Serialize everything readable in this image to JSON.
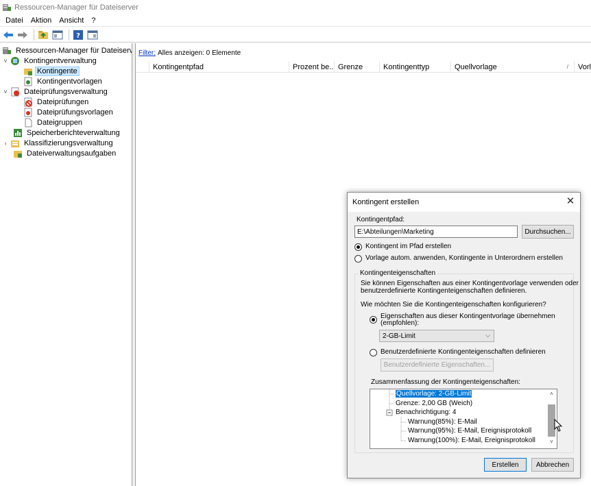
{
  "window": {
    "title": "Ressourcen-Manager für Dateiserver"
  },
  "menu": [
    "Datei",
    "Aktion",
    "Ansicht",
    "?"
  ],
  "toolbar": {
    "icons": [
      "back-arrow-icon",
      "forward-arrow-icon",
      "up-folder-icon",
      "show-hide-tree-icon",
      "help-icon",
      "panel-icon"
    ]
  },
  "tree": {
    "root": "Ressourcen-Manager für Dateiserver (l",
    "items": [
      {
        "label": "Kontingentverwaltung",
        "level": 1,
        "expander": "˅"
      },
      {
        "label": "Kontingente",
        "level": 2,
        "selected": true
      },
      {
        "label": "Kontingentvorlagen",
        "level": 2
      },
      {
        "label": "Dateiprüfungsverwaltung",
        "level": 1,
        "expander": "˅"
      },
      {
        "label": "Dateiprüfungen",
        "level": 2
      },
      {
        "label": "Dateiprüfungsvorlagen",
        "level": 2
      },
      {
        "label": "Dateigruppen",
        "level": 2
      },
      {
        "label": "Speicherberichteverwaltung",
        "level": 1
      },
      {
        "label": "Klassifizierungsverwaltung",
        "level": 1,
        "expander": "›"
      },
      {
        "label": "Dateiverwaltungsaufgaben",
        "level": 1
      }
    ]
  },
  "filter": {
    "link": "Filter:",
    "text": "Alles anzeigen: 0 Elemente"
  },
  "columns": [
    "Kontingentpfad",
    "Prozent be...",
    "Grenze",
    "Kontingenttyp",
    "Quellvorlage",
    "Vorla"
  ],
  "dialog": {
    "title": "Kontingent erstellen",
    "path_label": "Kontingentpfad:",
    "path_value": "E:\\Abteilungen\\Marketing",
    "browse": "Durchsuchen...",
    "radio_create": "Kontingent im Pfad erstellen",
    "radio_template": "Vorlage autom. anwenden, Kontingente in Unterordnern erstellen",
    "group_title": "Kontingenteigenschaften",
    "desc": [
      "Sie können Eigenschaften aus einer Kontingentvorlage verwenden oder",
      "benutzerdefinierte Kontingenteigenschaften definieren."
    ],
    "question": "Wie möchten Sie die Kontingenteigenschaften konfigurieren?",
    "radio_from_template": [
      "Eigenschaften aus dieser Kontingentvorlage übernehmen",
      "(empfohlen):"
    ],
    "template_value": "2-GB-Limit",
    "radio_custom": "Benutzerdefinierte Kontingenteigenschaften definieren",
    "custom_button": "Benutzerdefinierte Eigenschaften...",
    "summary_label": "Zusammenfassung der Kontingenteigenschaften:",
    "summary": [
      "Quellvorlage: 2-GB-Limit",
      "Grenze: 2,00 GB (Weich)",
      "Benachrichtigung: 4",
      "Warnung(85%): E-Mail",
      "Warnung(95%): E-Mail, Ereignisprotokoll",
      "Warnung(100%): E-Mail, Ereignisprotokoll"
    ],
    "create": "Erstellen",
    "cancel": "Abbrechen"
  },
  "colors": {
    "selection": "#0078d7",
    "tree_selected": "#cce8ff",
    "link": "#0033cc"
  }
}
